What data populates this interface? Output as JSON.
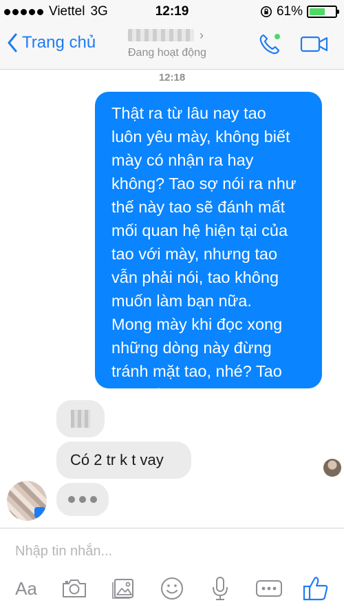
{
  "status_bar": {
    "carrier": "Viettel",
    "network": "3G",
    "time": "12:19",
    "battery_percent": "61%",
    "battery_level": 0.61
  },
  "nav": {
    "back_label": "Trang chủ",
    "name_chevron": "›",
    "contact_status": "Đang hoạt động"
  },
  "chat": {
    "timestamp": "12:18",
    "outgoing_message": "Thật ra từ lâu nay tao\nluôn yêu mày, không biết\nmày có nhận ra hay\nkhông? Tao sợ nói ra như\nthế này tao sẽ đánh mất\nmối quan hệ hiện tại của\ntao với mày, nhưng tao\nvẫn phải nói, tao không\nmuốn làm bạn nữa.\nMong mày khi đọc xong\nnhững dòng này đừng\ntránh mặt tao, nhé? Tao\nyêu mày !",
    "incoming_message": "Có 2 tr k t vay"
  },
  "composer": {
    "placeholder": "Nhập tin nhắn...",
    "aa_label": "Aa",
    "icons": [
      "camera-icon",
      "photo-icon",
      "emoji-icon",
      "microphone-icon",
      "more-icon",
      "like-icon"
    ]
  },
  "colors": {
    "accent": "#1e7cf2",
    "outgoing_bubble": "#0a84ff",
    "incoming_bubble": "#ebebeb"
  }
}
